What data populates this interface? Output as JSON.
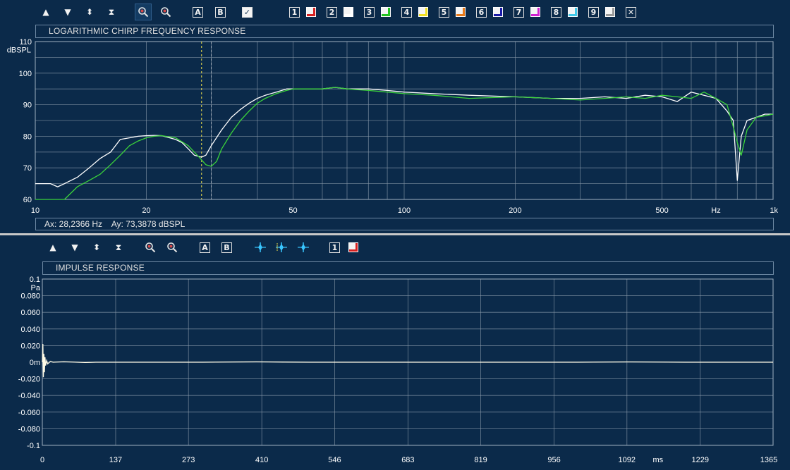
{
  "top_toolbar": {
    "icons": [
      "arrow-up-icon",
      "arrow-down-icon",
      "expand-vertical-icon",
      "compress-vertical-icon",
      "zoom-in-icon",
      "zoom-out-icon"
    ],
    "cursor_a": "A",
    "cursor_b": "B",
    "overlay_check": "✓",
    "channels": [
      {
        "num": "1",
        "color": "#d62020"
      },
      {
        "num": "2",
        "color": "#ffffff"
      },
      {
        "num": "3",
        "color": "#22c422"
      },
      {
        "num": "4",
        "color": "#f0e020"
      },
      {
        "num": "5",
        "color": "#e87a1a"
      },
      {
        "num": "6",
        "color": "#1a1aa8"
      },
      {
        "num": "7",
        "color": "#d020d0"
      },
      {
        "num": "8",
        "color": "#40c8e8"
      },
      {
        "num": "9",
        "color": "#9a9a9a"
      }
    ],
    "close": "✕"
  },
  "bottom_toolbar": {
    "icons": [
      "arrow-up-icon",
      "arrow-down-icon",
      "expand-vertical-icon",
      "compress-vertical-icon",
      "zoom-in-icon",
      "zoom-out-icon"
    ],
    "cursor_a": "A",
    "cursor_b": "B",
    "waveform_icons": [
      "impulse-marker-icon",
      "impulse-marker-left-icon",
      "impulse-marker-right-icon"
    ],
    "channel": {
      "num": "1",
      "color": "#d62020"
    }
  },
  "colors": {
    "background": "#0b2a4a",
    "grid": "#8a9aaa",
    "trace_white": "#ffffff",
    "trace_green": "#3bd33b",
    "impulse_trace": "#fffbe6",
    "cursor_a": "#f2e24a",
    "cursor_b": "#9aa7b3"
  },
  "status": {
    "ax": "Ax: 28,2366 Hz",
    "ay": "Ay: 73,3878 dBSPL"
  },
  "chart_data": [
    {
      "type": "line",
      "title": "LOGARITHMIC CHIRP FREQUENCY RESPONSE",
      "xlabel": "Hz",
      "ylabel": "dBSPL",
      "xscale": "log",
      "xlim": [
        10,
        1000
      ],
      "ylim": [
        60,
        110
      ],
      "x_ticks": [
        {
          "v": 10,
          "label": "10"
        },
        {
          "v": 20,
          "label": "20"
        },
        {
          "v": 50,
          "label": "50"
        },
        {
          "v": 100,
          "label": "100"
        },
        {
          "v": 200,
          "label": "200"
        },
        {
          "v": 500,
          "label": "500"
        },
        {
          "v": 1000,
          "label": "1k"
        }
      ],
      "y_ticks": [
        {
          "v": 60,
          "label": "60"
        },
        {
          "v": 70,
          "label": "70"
        },
        {
          "v": 80,
          "label": "80"
        },
        {
          "v": 90,
          "label": "90"
        },
        {
          "v": 100,
          "label": "100"
        },
        {
          "v": 110,
          "label": "110"
        }
      ],
      "grid": true,
      "cursors": [
        {
          "x": 28.2366,
          "style": "dashed-yellow"
        },
        {
          "x": 30.0,
          "style": "dashed-gray"
        }
      ],
      "series": [
        {
          "color": "#ffffff",
          "x": [
            10,
            11,
            11.5,
            12,
            13,
            14,
            15,
            16,
            17,
            18,
            19,
            20,
            21,
            22,
            24,
            25,
            26,
            27,
            28.2,
            29,
            30,
            32,
            34,
            36,
            38,
            40,
            42,
            45,
            48,
            50,
            55,
            60,
            65,
            70,
            80,
            90,
            100,
            120,
            150,
            200,
            250,
            300,
            350,
            400,
            450,
            500,
            550,
            600,
            650,
            700,
            750,
            780,
            800,
            820,
            850,
            900,
            950,
            1000
          ],
          "y": [
            65,
            65,
            64,
            65,
            67,
            70,
            73,
            75,
            79,
            79.5,
            80,
            80.2,
            80.3,
            80.2,
            79,
            78,
            76,
            74,
            73.4,
            74,
            77,
            82,
            86,
            88.5,
            90.5,
            92,
            93,
            94,
            95,
            95,
            95,
            95,
            95.5,
            95,
            95,
            94.5,
            94,
            93.5,
            93,
            92.5,
            92,
            92,
            92.5,
            92,
            93,
            92.5,
            91,
            94,
            93,
            92,
            88,
            85,
            66,
            80,
            85,
            86,
            87,
            87
          ]
        },
        {
          "color": "#3bd33b",
          "x": [
            10,
            12,
            13,
            14,
            15,
            16,
            17,
            18,
            19,
            20,
            21,
            22,
            24,
            26,
            28,
            29,
            30,
            31,
            32,
            34,
            36,
            38,
            40,
            42,
            45,
            48,
            50,
            55,
            60,
            65,
            70,
            80,
            90,
            100,
            120,
            150,
            200,
            250,
            300,
            350,
            400,
            450,
            500,
            550,
            600,
            650,
            700,
            750,
            780,
            800,
            820,
            850,
            900,
            950,
            1000
          ],
          "y": [
            60,
            60,
            64,
            66,
            68,
            71,
            74,
            77,
            78.5,
            79.5,
            80,
            80.2,
            79.5,
            77,
            73,
            71,
            70.5,
            72,
            76,
            81,
            85,
            88,
            90.5,
            92,
            93.5,
            94.5,
            95,
            95,
            95,
            95.5,
            95,
            94.5,
            94,
            93.5,
            93,
            92,
            92.5,
            92,
            91.5,
            92,
            92.5,
            92,
            93,
            92.5,
            92,
            94,
            92,
            90,
            83,
            78,
            74,
            82,
            86,
            86.5,
            87
          ]
        }
      ]
    },
    {
      "type": "line",
      "title": "IMPULSE RESPONSE",
      "xlabel": "ms",
      "ylabel": "Pa",
      "xlim": [
        0,
        1365
      ],
      "ylim": [
        -0.1,
        0.1
      ],
      "x_ticks": [
        {
          "v": 0,
          "label": "0"
        },
        {
          "v": 137,
          "label": "137"
        },
        {
          "v": 273,
          "label": "273"
        },
        {
          "v": 410,
          "label": "410"
        },
        {
          "v": 546,
          "label": "546"
        },
        {
          "v": 683,
          "label": "683"
        },
        {
          "v": 819,
          "label": "819"
        },
        {
          "v": 956,
          "label": "956"
        },
        {
          "v": 1092,
          "label": "1092"
        },
        {
          "v": 1229,
          "label": "1229"
        },
        {
          "v": 1365,
          "label": "1365"
        }
      ],
      "y_ticks": [
        {
          "v": 0.1,
          "label": "0.1"
        },
        {
          "v": 0.08,
          "label": "0.080"
        },
        {
          "v": 0.06,
          "label": "0.060"
        },
        {
          "v": 0.04,
          "label": "0.040"
        },
        {
          "v": 0.02,
          "label": "0.020"
        },
        {
          "v": 0,
          "label": "0m"
        },
        {
          "v": -0.02,
          "label": "-0.020"
        },
        {
          "v": -0.04,
          "label": "-0.040"
        },
        {
          "v": -0.06,
          "label": "-0.060"
        },
        {
          "v": -0.08,
          "label": "-0.080"
        },
        {
          "v": -0.1,
          "label": "-0.1"
        }
      ],
      "grid": true,
      "series": [
        {
          "color": "#fffbe6",
          "x": [
            0,
            1,
            2,
            3,
            4,
            5,
            6,
            8,
            10,
            15,
            20,
            40,
            80,
            100,
            300,
            400,
            450,
            500,
            1000,
            1100,
            1200,
            1365
          ],
          "y": [
            0,
            0.022,
            -0.018,
            0.01,
            -0.012,
            0.006,
            -0.004,
            0.002,
            -0.002,
            0.001,
            0,
            0.0005,
            -0.0003,
            0,
            0,
            0.0004,
            0.0002,
            0,
            0,
            0.0003,
            0,
            0
          ]
        }
      ]
    }
  ]
}
